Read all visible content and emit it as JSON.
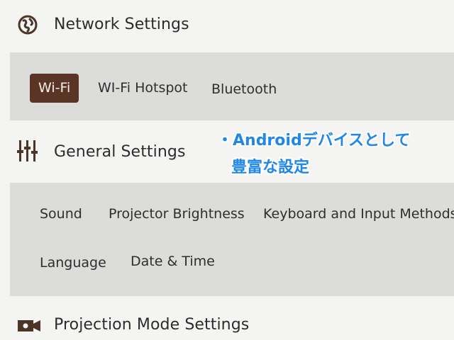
{
  "network_settings": {
    "title": "Network Settings",
    "icon": "globe-icon",
    "tabs": [
      {
        "label": "Wi-Fi",
        "selected": true
      },
      {
        "label": "WI-Fi Hotspot",
        "selected": false
      },
      {
        "label": "Bluetooth",
        "selected": false
      }
    ]
  },
  "general_settings": {
    "title": "General Settings",
    "icon": "sliders-icon",
    "items": [
      {
        "label": "Sound"
      },
      {
        "label": "Projector Brightness"
      },
      {
        "label": "Keyboard and Input Methods"
      },
      {
        "label": "Language"
      },
      {
        "label": "Date & Time"
      }
    ]
  },
  "projection_mode_settings": {
    "title": "Projection Mode Settings",
    "icon": "camera-icon"
  },
  "callout": {
    "line1": "・Androidデバイスとして",
    "line2": "豊富な設定"
  },
  "colors": {
    "background": "#f4f4f2",
    "panel": "#dcdcda",
    "selected_tab": "#5a3526",
    "callout_text": "#1f87ea"
  }
}
